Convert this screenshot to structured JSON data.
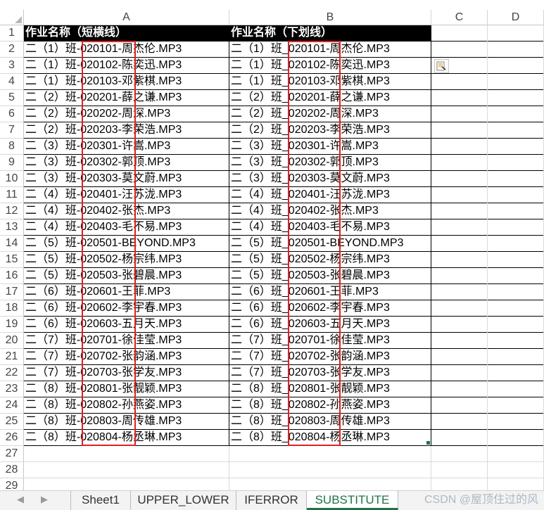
{
  "columns": [
    "A",
    "B",
    "C",
    "D"
  ],
  "headers": {
    "a": "作业名称（短横线）",
    "b": "作业名称（下划线）"
  },
  "rows_a": [
    "二（1）班-020101-周杰伦.MP3",
    "二（1）班-020102-陈奕迅.MP3",
    "二（1）班-020103-邓紫棋.MP3",
    "二（2）班-020201-薛之谦.MP3",
    "二（2）班-020202-周深.MP3",
    "二（2）班-020203-李荣浩.MP3",
    "二（3）班-020301-许嵩.MP3",
    "二（3）班-020302-郭顶.MP3",
    "二（3）班-020303-莫文蔚.MP3",
    "二（4）班-020401-汪苏泷.MP3",
    "二（4）班-020402-张杰.MP3",
    "二（4）班-020403-毛不易.MP3",
    "二（5）班-020501-BEYOND.MP3",
    "二（5）班-020502-杨宗纬.MP3",
    "二（5）班-020503-张碧晨.MP3",
    "二（6）班-020601-王菲.MP3",
    "二（6）班-020602-李宇春.MP3",
    "二（6）班-020603-五月天.MP3",
    "二（7）班-020701-徐佳莹.MP3",
    "二（7）班-020702-张韵涵.MP3",
    "二（7）班-020703-张学友.MP3",
    "二（8）班-020801-张靓颖.MP3",
    "二（8）班-020802-孙燕姿.MP3",
    "二（8）班-020803-周传雄.MP3",
    "二（8）班-020804-杨丞琳.MP3"
  ],
  "rows_b": [
    "二（1）班_020101-周杰伦.MP3",
    "二（1）班_020102-陈奕迅.MP3",
    "二（1）班_020103-邓紫棋.MP3",
    "二（2）班_020201-薛之谦.MP3",
    "二（2）班_020202-周深.MP3",
    "二（2）班_020203-李荣浩.MP3",
    "二（3）班_020301-许嵩.MP3",
    "二（3）班_020302-郭顶.MP3",
    "二（3）班_020303-莫文蔚.MP3",
    "二（4）班_020401-汪苏泷.MP3",
    "二（4）班_020402-张杰.MP3",
    "二（4）班_020403-毛不易.MP3",
    "二（5）班_020501-BEYOND.MP3",
    "二（5）班_020502-杨宗纬.MP3",
    "二（5）班_020503-张碧晨.MP3",
    "二（6）班_020601-王菲.MP3",
    "二（6）班_020602-李宇春.MP3",
    "二（6）班_020603-五月天.MP3",
    "二（7）班_020701-徐佳莹.MP3",
    "二（7）班_020702-张韵涵.MP3",
    "二（7）班_020703-张学友.MP3",
    "二（8）班_020801-张靓颖.MP3",
    "二（8）班_020802-孙燕姿.MP3",
    "二（8）班_020803-周传雄.MP3",
    "二（8）班_020804-杨丞琳.MP3"
  ],
  "row_numbers": [
    "1",
    "2",
    "3",
    "4",
    "5",
    "6",
    "7",
    "8",
    "9",
    "10",
    "11",
    "12",
    "13",
    "14",
    "15",
    "16",
    "17",
    "18",
    "19",
    "20",
    "21",
    "22",
    "23",
    "24",
    "25",
    "26",
    "27",
    "28",
    "29"
  ],
  "tabs": [
    {
      "label": "Sheet1",
      "active": false
    },
    {
      "label": "UPPER_LOWER",
      "active": false
    },
    {
      "label": "IFERROR",
      "active": false
    },
    {
      "label": "SUBSTITUTE",
      "active": true
    }
  ],
  "watermark": "CSDN @屋顶住过的风",
  "colors": {
    "header_bg": "#000000",
    "highlight": "#e02020",
    "active_tab": "#217346"
  },
  "icons": {
    "nav_prev": "triangle-left-icon",
    "nav_next": "triangle-right-icon",
    "paste_options": "paste-options-icon"
  }
}
